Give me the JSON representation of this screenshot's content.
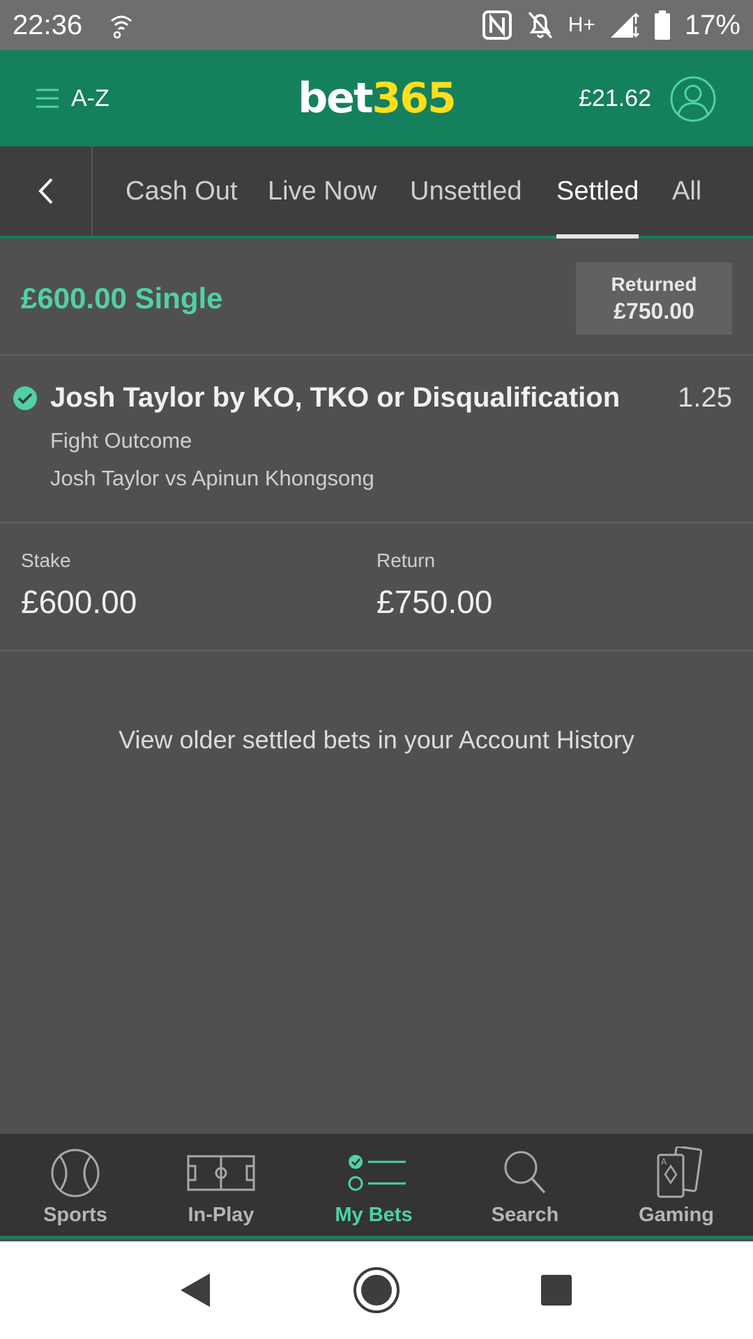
{
  "status_bar": {
    "time": "22:36",
    "network": "H+",
    "battery": "17%"
  },
  "header": {
    "menu_label": "A-Z",
    "logo_part1": "bet",
    "logo_part2": "365",
    "balance": "£21.62",
    "brand_color": "#14805e",
    "logo_accent": "#ffdf1b"
  },
  "tabs": [
    {
      "label": "Cash Out"
    },
    {
      "label": "Live Now"
    },
    {
      "label": "Unsettled"
    },
    {
      "label": "Settled"
    },
    {
      "label": "All"
    }
  ],
  "bet": {
    "title": "£600.00 Single",
    "returned_label": "Returned",
    "returned_amount": "£750.00",
    "selection": "Josh Taylor by KO, TKO or Disqualification",
    "odds": "1.25",
    "market": "Fight Outcome",
    "fixture": "Josh Taylor vs Apinun Khongsong",
    "stake_label": "Stake",
    "stake_value": "£600.00",
    "return_label": "Return",
    "return_value": "£750.00",
    "accent_color": "#4fd1a5"
  },
  "footer_message": "View older settled bets in your Account History",
  "bottom_nav": [
    {
      "label": "Sports",
      "icon": "tennis-ball-icon"
    },
    {
      "label": "In-Play",
      "icon": "pitch-icon"
    },
    {
      "label": "My Bets",
      "icon": "my-bets-icon"
    },
    {
      "label": "Search",
      "icon": "search-icon"
    },
    {
      "label": "Gaming",
      "icon": "cards-icon"
    }
  ]
}
